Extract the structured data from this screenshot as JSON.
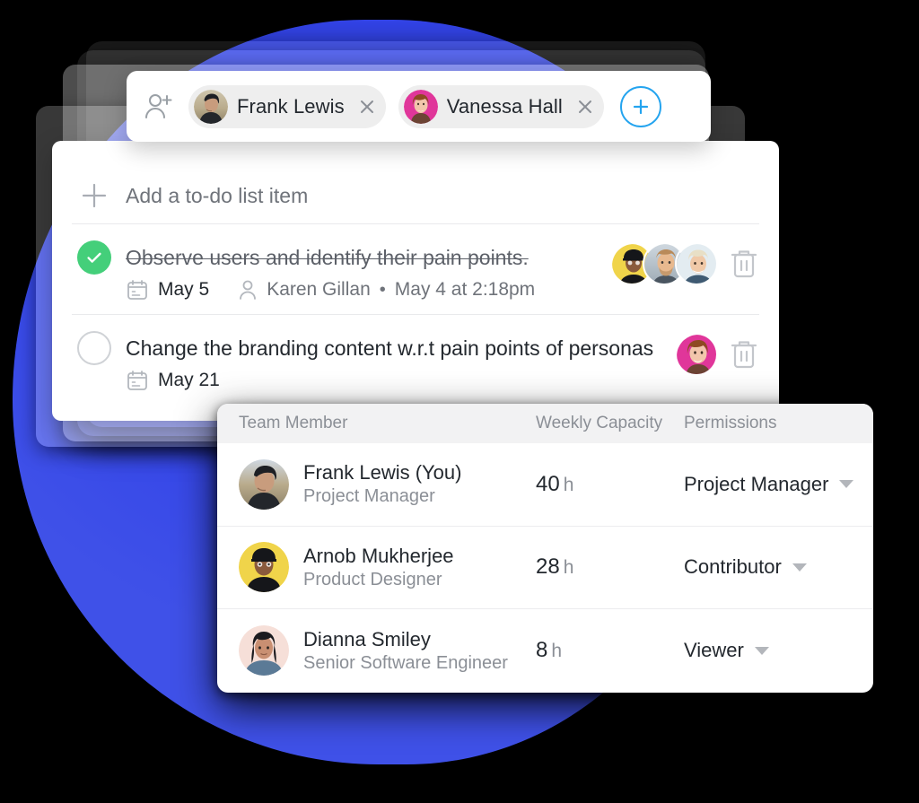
{
  "chips_bar": {
    "add_person_icon": "person-add-icon",
    "add_button_icon": "plus-icon",
    "chips": [
      {
        "name": "Frank Lewis",
        "remove_icon": "close-icon",
        "avatar": "frank-avatar"
      },
      {
        "name": "Vanessa Hall",
        "remove_icon": "close-icon",
        "avatar": "vanessa-avatar"
      }
    ]
  },
  "todo": {
    "add_placeholder": "Add a to-do list item",
    "add_icon": "plus-icon",
    "items": [
      {
        "title": "Observe users and identify their pain points.",
        "completed": true,
        "due_date": "May 5",
        "assignee": "Karen Gillan",
        "separator": "•",
        "timestamp": "May 4 at 2:18pm",
        "calendar_icon": "calendar-icon",
        "user_icon": "user-icon",
        "delete_icon": "trash-icon",
        "avatars": [
          "arnob-avatar",
          "man-avatar",
          "woman-avatar"
        ]
      },
      {
        "title": "Change the branding content w.r.t pain points of personas",
        "completed": false,
        "due_date": "May 21",
        "calendar_icon": "calendar-icon",
        "delete_icon": "trash-icon",
        "avatars": [
          "vanessa-avatar"
        ]
      }
    ]
  },
  "team_table": {
    "headers": {
      "member": "Team Member",
      "capacity": "Weekly Capacity",
      "permissions": "Permissions"
    },
    "rows": [
      {
        "name": "Frank Lewis (You)",
        "role": "Project Manager",
        "capacity_value": "40",
        "capacity_unit": "h",
        "permission": "Project Manager",
        "caret_icon": "chevron-down-icon",
        "avatar": "frank-avatar"
      },
      {
        "name": "Arnob Mukherjee",
        "role": "Product Designer",
        "capacity_value": "28",
        "capacity_unit": "h",
        "permission": "Contributor",
        "caret_icon": "chevron-down-icon",
        "avatar": "arnob-avatar"
      },
      {
        "name": "Dianna Smiley",
        "role": "Senior Software Engineer",
        "capacity_value": "8",
        "capacity_unit": "h",
        "permission": "Viewer",
        "caret_icon": "chevron-down-icon",
        "avatar": "dianna-avatar"
      }
    ]
  },
  "theme": {
    "blue_blob": "#3344e8",
    "accent_blue": "#24a4ef",
    "success_green": "#44cf7a",
    "text_primary": "#23282e",
    "text_muted": "#8b8f96",
    "header_bg": "#f2f2f3"
  }
}
